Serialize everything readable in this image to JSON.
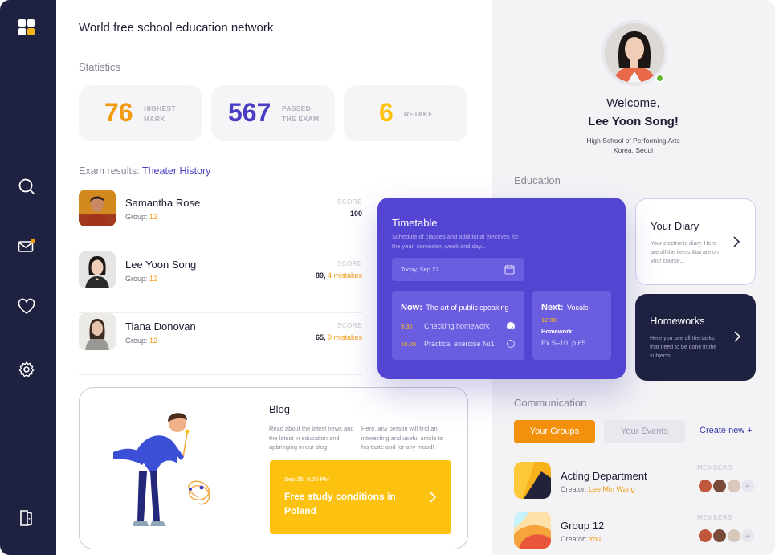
{
  "header": {
    "title": "World free school education network"
  },
  "statistics": {
    "label": "Statistics",
    "cards": [
      {
        "value": "76",
        "label_line1": "HIGHEST",
        "label_line2": "MARK",
        "color": "#f29a12"
      },
      {
        "value": "567",
        "label_line1": "PASSED",
        "label_line2": "THE EXAM",
        "color": "#4a3fc4"
      },
      {
        "value": "6",
        "label_line1": "RETAKE",
        "label_line2": "",
        "color": "#fdc210"
      }
    ]
  },
  "exam": {
    "label": "Exam results:",
    "subject": "Theater History",
    "score_label": "SCORE",
    "group_prefix": "Group:",
    "rows": [
      {
        "name": "Samantha Rose",
        "group": "12",
        "score": "100",
        "mistakes": ""
      },
      {
        "name": "Lee Yoon Song",
        "group": "12",
        "score": "89,",
        "mistakes": "4 mistakes"
      },
      {
        "name": "Tiana Donovan",
        "group": "12",
        "score": "65,",
        "mistakes": "9 mistakes"
      }
    ]
  },
  "blog": {
    "title": "Blog",
    "text_left": "Read about the latest news and the latest in education and upbringing in our blog",
    "text_right": "Here, any person will find an interesting and useful article to his taste and for any mood!",
    "featured": {
      "date": "Sep 25, 8:00 PM",
      "title": "Free study conditions in Poland"
    }
  },
  "profile": {
    "greeting": "Welcome,",
    "name": "Lee Yoon Song!",
    "school": "High School of Performing Arts",
    "location": "Korea, Seoul"
  },
  "education": {
    "label": "Education",
    "diary": {
      "title": "Your Diary",
      "text": "Your electronic diary. Here are all the items that are on your course..."
    },
    "homeworks": {
      "title": "Homeworks",
      "text": "Here you see all the tasks that need to be done in the subjects..."
    }
  },
  "timetable": {
    "title": "Timetable",
    "subtitle": "Schedule of classes and additional electives for the year, semester, week and day...",
    "date": "Today, Sep 27",
    "now_label": "Now:",
    "now_subject": "The art of public speaking",
    "tasks": [
      {
        "time": "9.30",
        "task": "Checking homework",
        "done": true
      },
      {
        "time": "10.00",
        "task": "Practical exercise №1",
        "done": false
      }
    ],
    "next_label": "Next:",
    "next_subject": "Vocals",
    "next_time": "12.00",
    "homework_label": "Homework:",
    "homework_text": "Ex 5–10, p 65"
  },
  "communication": {
    "label": "Communication",
    "tab_groups": "Your Groups",
    "tab_events": "Your Events",
    "create_new": "Create new +",
    "members_label": "MEMBERS",
    "creator_prefix": "Creator:",
    "groups": [
      {
        "name": "Acting Department",
        "creator": "Lee Min Wang"
      },
      {
        "name": "Group 12",
        "creator": "You"
      }
    ]
  },
  "sidebar": {
    "icons": [
      "dashboard-icon",
      "search-icon",
      "mail-icon",
      "heart-icon",
      "settings-icon",
      "logout-icon"
    ]
  }
}
